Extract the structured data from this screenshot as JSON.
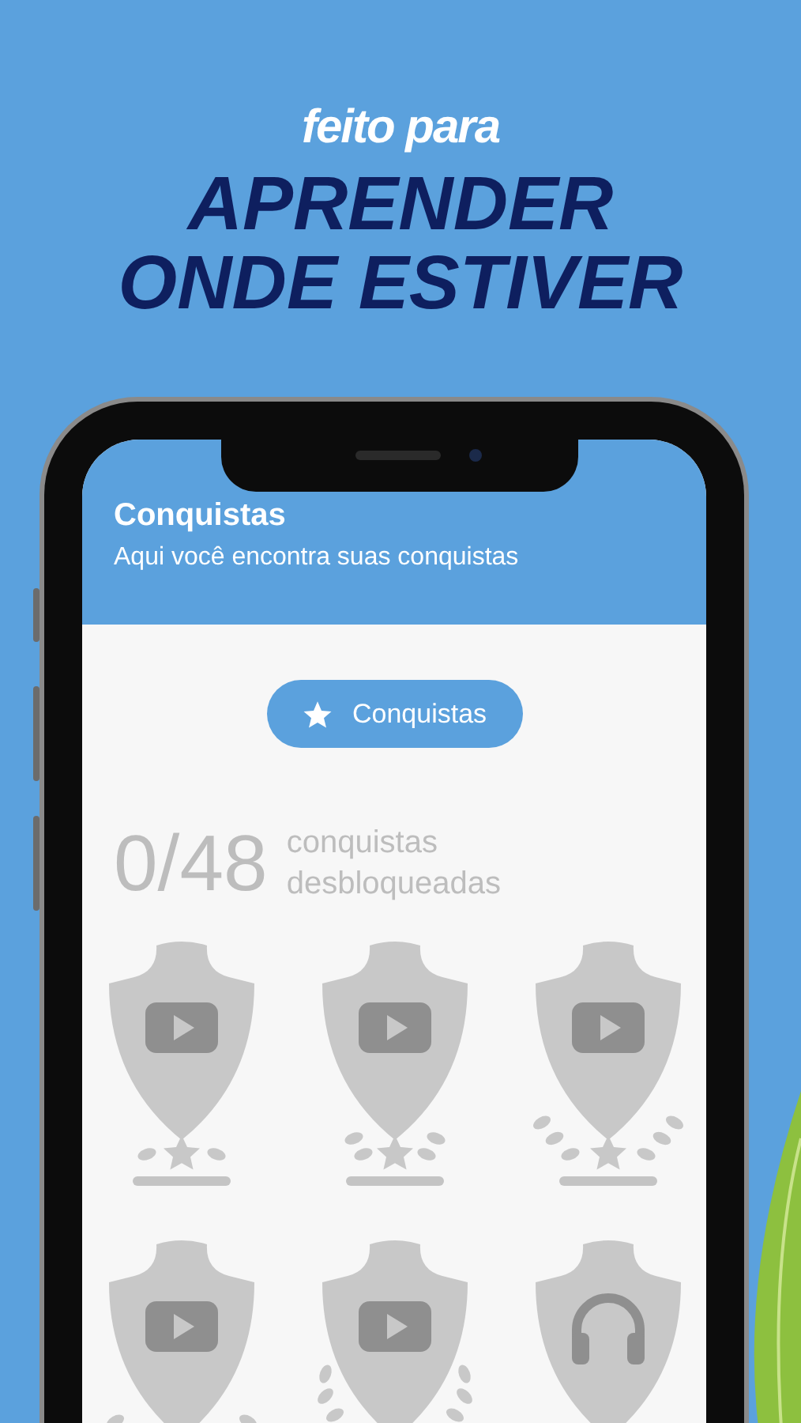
{
  "promo": {
    "kicker": "feito para",
    "headline": [
      "APRENDER",
      "ONDE ESTIVER"
    ]
  },
  "screen": {
    "header": {
      "title": "Conquistas",
      "subtitle": "Aqui você encontra suas conquistas"
    },
    "filter_button": {
      "label": "Conquistas"
    },
    "summary": {
      "count": "0/48",
      "label": "conquistas desbloqueadas"
    },
    "badges": [
      {
        "kind": "video_small",
        "level": 0
      },
      {
        "kind": "video_medium",
        "level": 0
      },
      {
        "kind": "video_large",
        "level": 0
      },
      {
        "kind": "video_large"
      },
      {
        "kind": "video_full"
      },
      {
        "kind": "headphones_plain"
      }
    ]
  }
}
